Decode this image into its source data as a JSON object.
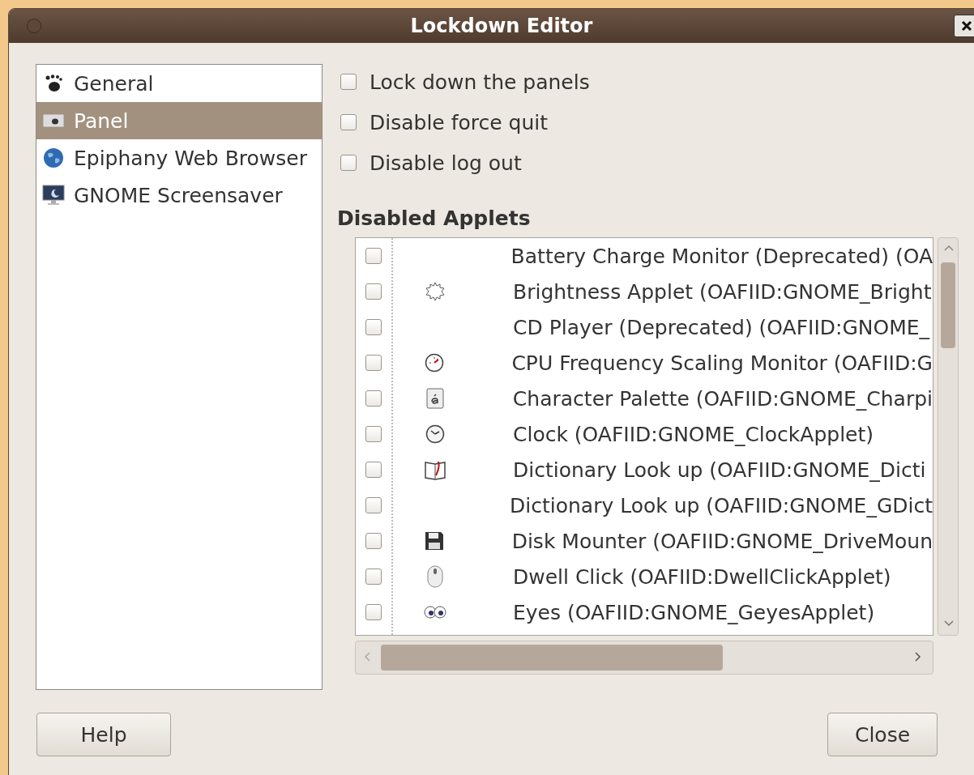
{
  "window": {
    "title": "Lockdown Editor"
  },
  "sidebar": {
    "items": [
      {
        "label": "General",
        "kind": "foot",
        "selected": false
      },
      {
        "label": "Panel",
        "kind": "panel",
        "selected": true
      },
      {
        "label": "Epiphany Web Browser",
        "kind": "globe",
        "selected": false
      },
      {
        "label": "GNOME Screensaver",
        "kind": "monitor",
        "selected": false
      }
    ]
  },
  "options": [
    {
      "label": "Lock down the panels",
      "checked": false
    },
    {
      "label": "Disable force quit",
      "checked": false
    },
    {
      "label": "Disable log out",
      "checked": false
    }
  ],
  "disabled_applets": {
    "heading": "Disabled Applets",
    "rows": [
      {
        "name": "Battery Charge Monitor (Deprecated) (OA",
        "kind": "none",
        "checked": false
      },
      {
        "name": "Brightness Applet (OAFIID:GNOME_Bright",
        "kind": "gear",
        "checked": false
      },
      {
        "name": "CD Player (Deprecated) (OAFIID:GNOME_",
        "kind": "none",
        "checked": false
      },
      {
        "name": "CPU Frequency Scaling Monitor (OAFIID:G",
        "kind": "gauge",
        "checked": false
      },
      {
        "name": "Character Palette (OAFIID:GNOME_Charpi",
        "kind": "char",
        "checked": false
      },
      {
        "name": "Clock (OAFIID:GNOME_ClockApplet)",
        "kind": "clock",
        "checked": false
      },
      {
        "name": "Dictionary Look up (OAFIID:GNOME_Dicti",
        "kind": "book",
        "checked": false
      },
      {
        "name": "Dictionary Look up (OAFIID:GNOME_GDict",
        "kind": "none",
        "checked": false
      },
      {
        "name": "Disk Mounter (OAFIID:GNOME_DriveMoun",
        "kind": "floppy",
        "checked": false
      },
      {
        "name": "Dwell Click (OAFIID:DwellClickApplet)",
        "kind": "mouse",
        "checked": false
      },
      {
        "name": "Eyes (OAFIID:GNOME_GeyesApplet)",
        "kind": "eyes",
        "checked": false
      }
    ]
  },
  "buttons": [
    {
      "label": "Help",
      "kind": "help"
    },
    {
      "label": "Close",
      "kind": "close"
    }
  ]
}
